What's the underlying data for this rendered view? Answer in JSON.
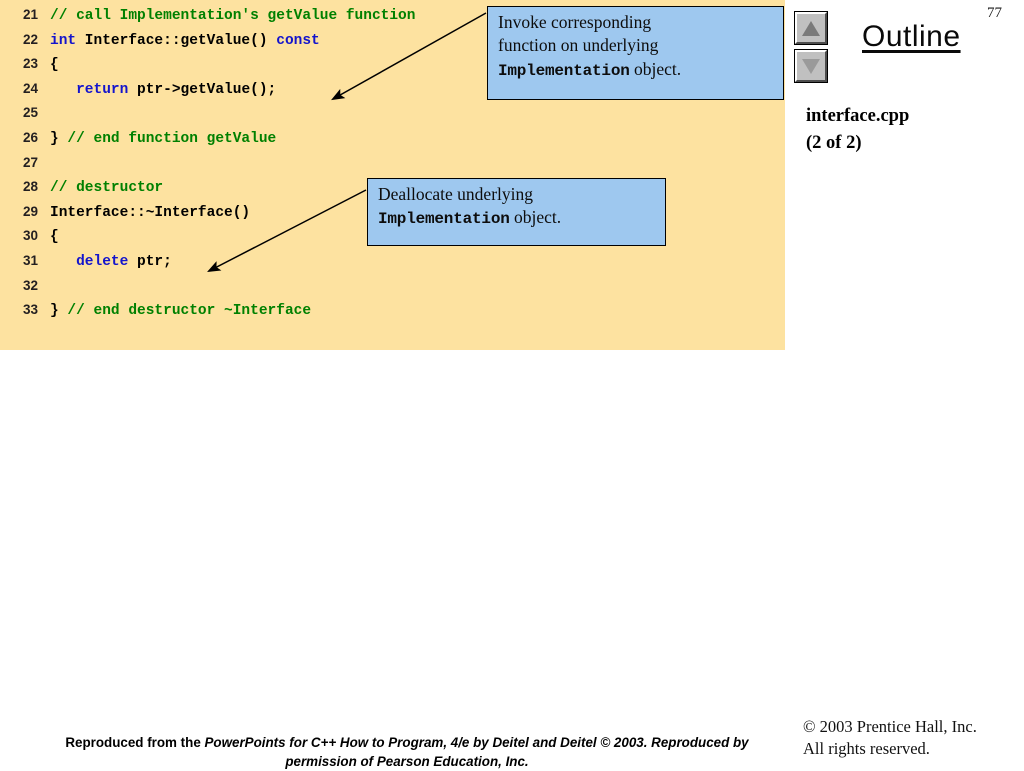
{
  "slide": {
    "page_number": "77",
    "outline_title": "Outline",
    "file_name": "interface.cpp",
    "file_part": "(2 of 2)"
  },
  "nav": {
    "up_icon": "triangle-up-icon",
    "down_icon": "triangle-down-icon"
  },
  "code": {
    "background_color": "#fde2a0",
    "comment_color": "#008000",
    "keyword_color": "#1414cc",
    "lines": [
      {
        "number": "21",
        "segments": [
          {
            "text": "// call Implementation's getValue function",
            "cls": "cmt"
          }
        ]
      },
      {
        "number": "22",
        "segments": [
          {
            "text": "int",
            "cls": "kw"
          },
          {
            "text": " Interface::getValue() ",
            "cls": "pl"
          },
          {
            "text": "const",
            "cls": "kw"
          }
        ]
      },
      {
        "number": "23",
        "segments": [
          {
            "text": "{",
            "cls": "pl"
          }
        ]
      },
      {
        "number": "24",
        "segments": [
          {
            "text": "   ",
            "cls": "pl"
          },
          {
            "text": "return",
            "cls": "kw"
          },
          {
            "text": " ptr->getValue();",
            "cls": "pl"
          }
        ]
      },
      {
        "number": "25",
        "segments": []
      },
      {
        "number": "26",
        "segments": [
          {
            "text": "} ",
            "cls": "pl"
          },
          {
            "text": "// end function getValue",
            "cls": "cmt"
          }
        ]
      },
      {
        "number": "27",
        "segments": []
      },
      {
        "number": "28",
        "segments": [
          {
            "text": "// destructor",
            "cls": "cmt"
          }
        ]
      },
      {
        "number": "29",
        "segments": [
          {
            "text": "Interface::~Interface()",
            "cls": "pl"
          }
        ]
      },
      {
        "number": "30",
        "segments": [
          {
            "text": "{",
            "cls": "pl"
          }
        ]
      },
      {
        "number": "31",
        "segments": [
          {
            "text": "   ",
            "cls": "pl"
          },
          {
            "text": "delete",
            "cls": "kw"
          },
          {
            "text": " ptr;",
            "cls": "pl"
          }
        ]
      },
      {
        "number": "32",
        "segments": []
      },
      {
        "number": "33",
        "segments": [
          {
            "text": "} ",
            "cls": "pl"
          },
          {
            "text": "// end destructor ~Interface",
            "cls": "cmt"
          }
        ]
      }
    ]
  },
  "callouts": {
    "background_color": "#9ec8ef",
    "invoke": {
      "line1": "Invoke corresponding",
      "line2": "function on underlying",
      "mono": "Implementation",
      "line3_tail": " object."
    },
    "deallocate": {
      "line1": "Deallocate underlying",
      "mono": "Implementation",
      "line2_tail": " object."
    }
  },
  "footer": {
    "credit_prefix": "Reproduced from the ",
    "credit_italic": "PowerPoints for C++ How to Program, 4/e by Deitel and Deitel © 2003. Reproduced by permission of Pearson Education, Inc.",
    "copyright_line1": "© 2003 Prentice Hall, Inc.",
    "copyright_line2": "All rights reserved."
  }
}
